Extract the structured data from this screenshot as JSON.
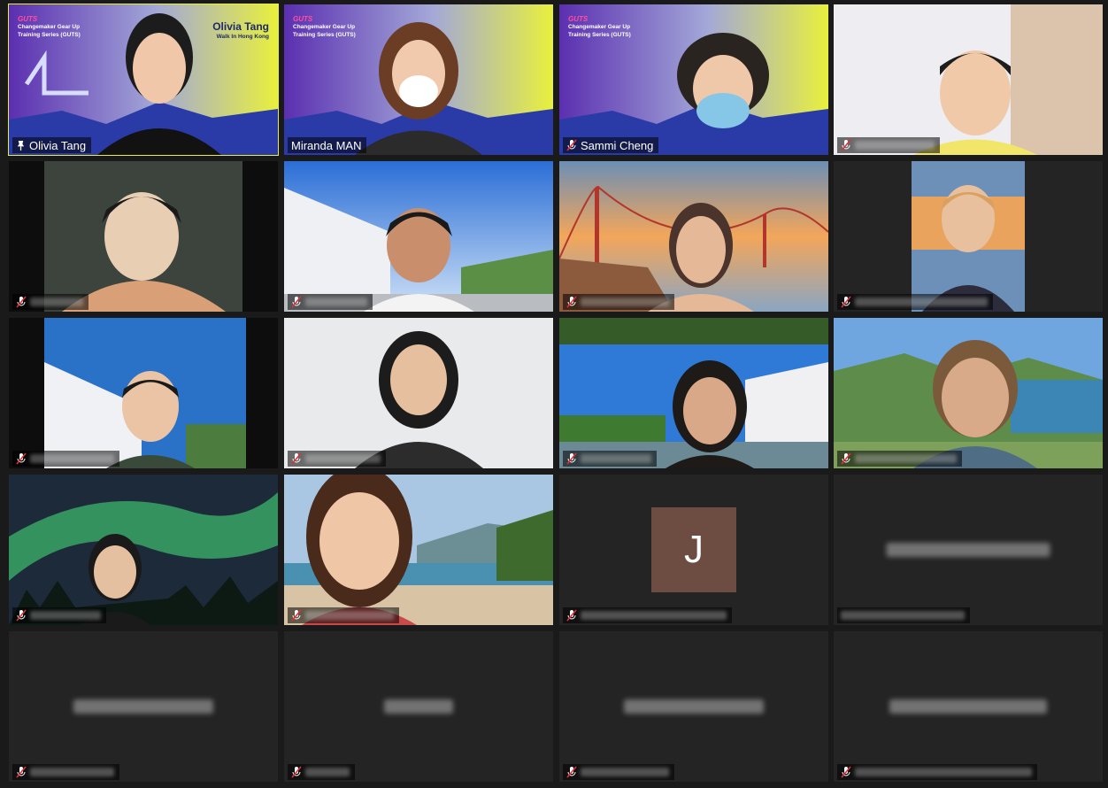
{
  "meeting": {
    "banner": {
      "brand_lines": [
        "Changemaker Gear Up",
        "Training Series (GUTS)"
      ],
      "presenter_name": "Olivia Tang",
      "presenter_sub": "Walk In Hong Kong"
    },
    "avatar_initial": "J",
    "named_participants": [
      "Olivia Tang",
      "Miranda MAN",
      "Sammi Cheng"
    ],
    "colors": {
      "active_speaker_border": "#e6ef3f",
      "background": "#1a1a1a",
      "tile_empty": "#242424",
      "avatar_bg": "#6d4c41",
      "mic_muted": "#e0303a"
    }
  }
}
